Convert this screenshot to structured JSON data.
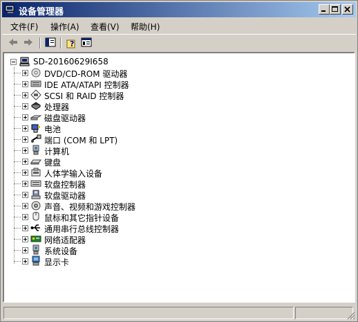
{
  "window": {
    "title": "设备管理器"
  },
  "menubar": {
    "items": [
      "文件(F)",
      "操作(A)",
      "查看(V)",
      "帮助(H)"
    ]
  },
  "toolbar": {
    "icons": [
      "back-arrow-icon",
      "forward-arrow-icon",
      "properties-icon",
      "help-icon",
      "console-tree-icon"
    ]
  },
  "tree": {
    "root": "SD-20160629I658",
    "items": [
      "DVD/CD-ROM 驱动器",
      "IDE ATA/ATAPI 控制器",
      "SCSI 和 RAID 控制器",
      "处理器",
      "磁盘驱动器",
      "电池",
      "端口 (COM 和 LPT)",
      "计算机",
      "键盘",
      "人体学输入设备",
      "软盘控制器",
      "软盘驱动器",
      "声音、视频和游戏控制器",
      "鼠标和其它指针设备",
      "通用串行总线控制器",
      "网络适配器",
      "系统设备",
      "显示卡"
    ]
  },
  "colors": {
    "title_start": "#0a246a",
    "title_end": "#a6caf0",
    "face": "#d4d0c8"
  }
}
